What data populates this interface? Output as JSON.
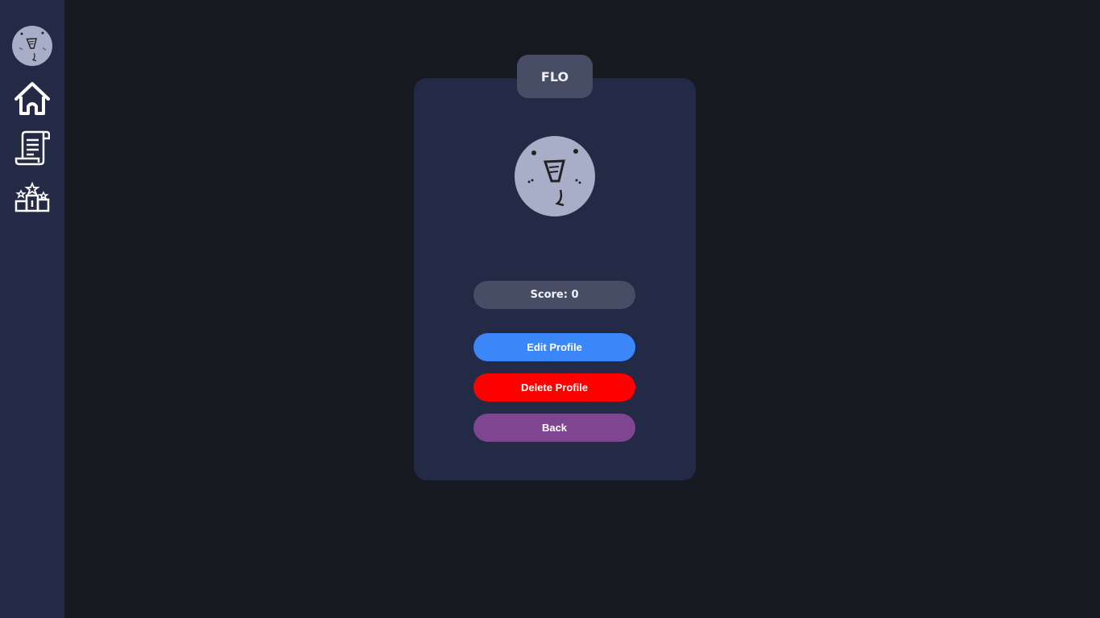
{
  "sidebar": {
    "items": [
      {
        "icon": "avatar-icon"
      },
      {
        "icon": "home-icon"
      },
      {
        "icon": "scroll-document-icon"
      },
      {
        "icon": "podium-leaderboard-icon"
      }
    ]
  },
  "profile": {
    "username": "FLO",
    "score_text": "Score: 0",
    "avatar_icon": "drawn-face-avatar"
  },
  "actions": {
    "edit_label": "Edit Profile",
    "delete_label": "Delete Profile",
    "back_label": "Back"
  },
  "colors": {
    "background": "#171921",
    "sidebar": "#232a45",
    "card": "#232a45",
    "tab": "#474d65",
    "edit": "#3b86f8",
    "delete": "#fe0000",
    "back": "#7e4590",
    "avatar": "#a9aec8"
  }
}
